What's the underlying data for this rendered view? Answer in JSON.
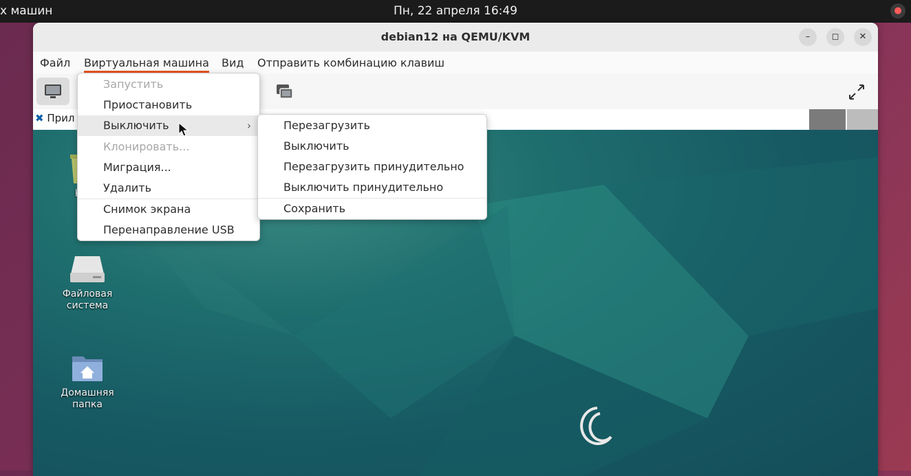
{
  "topbar": {
    "app_name": "х машин",
    "clock": "Пн, 22 апреля  16:49"
  },
  "window": {
    "title": "debian12 на QEMU/KVM"
  },
  "menubar": {
    "items": [
      "Файл",
      "Виртуальная машина",
      "Вид",
      "Отправить комбинацию клавиш"
    ]
  },
  "vm_status": {
    "app_label": "Прил"
  },
  "vm_menu": {
    "items": [
      {
        "label": "Запустить",
        "disabled": true
      },
      {
        "label": "Приостановить"
      },
      {
        "label": "Выключить",
        "submenu": true,
        "hover": true
      },
      {
        "label": "Клонировать...",
        "disabled": true
      },
      {
        "label": "Миграция..."
      },
      {
        "label": "Удалить"
      },
      {
        "label": "Снимок экрана"
      },
      {
        "label": "Перенаправление USB"
      }
    ]
  },
  "shutdown_submenu": {
    "items": [
      {
        "label": "Перезагрузить"
      },
      {
        "label": "Выключить"
      },
      {
        "label": "Перезагрузить принудительно"
      },
      {
        "label": "Выключить принудительно"
      },
      {
        "label": "Сохранить"
      }
    ]
  },
  "desktop": {
    "icons": [
      {
        "label": "Ко",
        "icon": "trash-icon"
      },
      {
        "label_line1": "Файловая",
        "label_line2": "система",
        "icon": "drive-icon"
      },
      {
        "label_line1": "Домашняя",
        "label_line2": "папка",
        "icon": "home-folder-icon"
      }
    ]
  },
  "colors": {
    "accent": "#e95420",
    "vm_background": "#1b6466",
    "topbar": "#1b1b1b"
  }
}
